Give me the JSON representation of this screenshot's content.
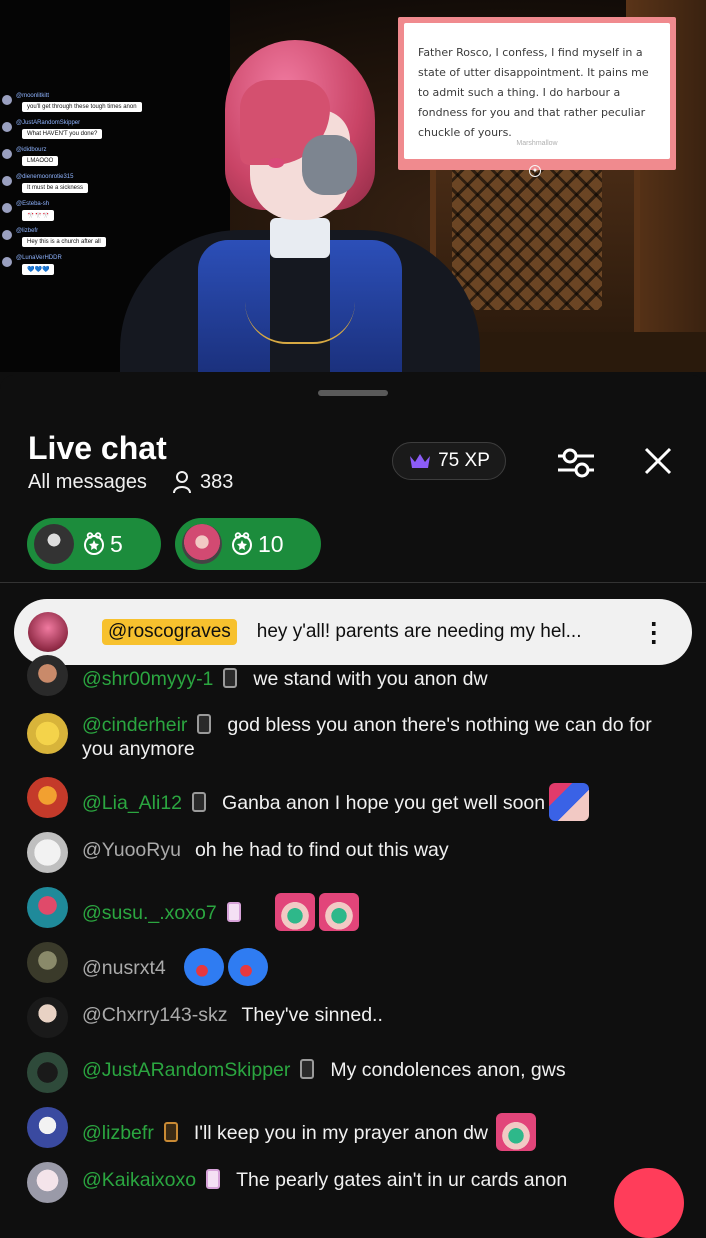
{
  "stream": {
    "overlay_chat": [
      {
        "user": "@moonlitkitt",
        "text": "you'll get through these tough times anon"
      },
      {
        "user": "@JustARandomSkipper",
        "text": "What HAVEN'T you done?"
      },
      {
        "user": "@ididbourz",
        "text": "LMAOOO"
      },
      {
        "user": "@dienemoonrotie315",
        "text": "It must be a sickness"
      },
      {
        "user": "@Esteba-sh",
        "text": "🎌🎌🎌"
      },
      {
        "user": "@lizbefr",
        "text": "Hey this is a church after all"
      },
      {
        "user": "@LunaVerHDDR",
        "text": "💙💙💙"
      }
    ],
    "marshmallow": {
      "text": "Father Rosco, I confess, I find myself in a state of utter disappointment. It pains me to admit such a thing. I do harbour a fondness for you and that rather peculiar chuckle of yours.",
      "brand": "Marshmallow"
    }
  },
  "chat": {
    "title": "Live chat",
    "filter_label": "All messages",
    "viewer_count": "383",
    "xp": "75 XP",
    "stickers": [
      {
        "count": "5"
      },
      {
        "count": "10"
      }
    ],
    "pinned": {
      "author": "@roscograves",
      "text": "hey y'all! parents are needing my hel..."
    },
    "messages": [
      {
        "author": "@shr00myyy-1",
        "text": "we stand with you anon dw"
      },
      {
        "author": "@cinderheir",
        "text": "god bless you anon there's nothing we can do for you anymore"
      },
      {
        "author": "@Lia_Ali12",
        "text": "Ganba anon I hope you get well soon"
      },
      {
        "author": "@YuooRyu",
        "text": "oh he had to find out this way"
      },
      {
        "author": "@susu._.xoxo7",
        "text": ""
      },
      {
        "author": "@nusrxt4",
        "text": ""
      },
      {
        "author": "@Chxrry143-skz",
        "text": "They've sinned.."
      },
      {
        "author": "@JustARandomSkipper",
        "text": "My condolences anon, gws"
      },
      {
        "author": "@lizbefr",
        "text": "I'll keep you in my prayer anon dw"
      },
      {
        "author": "@Kaikaixoxo",
        "text": "The pearly gates ain't in ur cards anon"
      }
    ]
  },
  "colors": {
    "member_name": "#2ba640",
    "pinned_author_bg": "#f7c12e",
    "sticker_bg": "#1c8c3c",
    "xp_crown": "#8b5cf6"
  }
}
